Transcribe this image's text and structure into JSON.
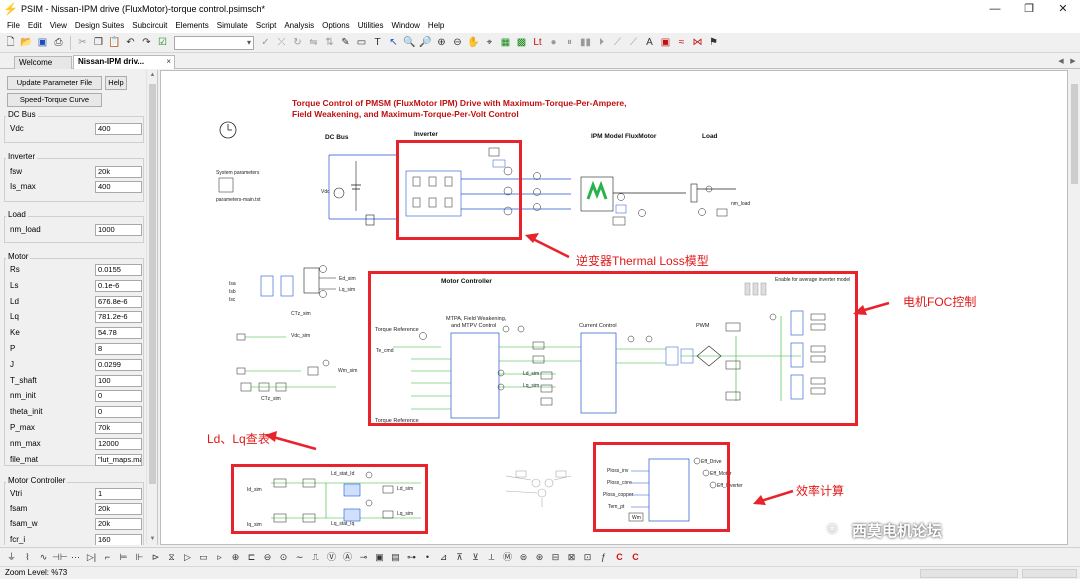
{
  "window": {
    "title": "PSIM - Nissan-IPM drive (FluxMotor)-torque control.psimsch*",
    "minimize": "—",
    "maximize": "❐",
    "close": "✕"
  },
  "menu": [
    "File",
    "Edit",
    "View",
    "Design Suites",
    "Subcircuit",
    "Elements",
    "Simulate",
    "Script",
    "Analysis",
    "Options",
    "Utilities",
    "Window",
    "Help"
  ],
  "tabs": {
    "welcome": "Welcome",
    "active": "Nissan-IPM driv...",
    "close": "×"
  },
  "panel": {
    "buttons": {
      "update": "Update Parameter File",
      "help": "Help",
      "speed_torque": "Speed-Torque Curve"
    },
    "groups": {
      "dc_bus": {
        "title": "DC Bus",
        "params": [
          {
            "label": "Vdc",
            "value": "400"
          }
        ]
      },
      "inverter": {
        "title": "Inverter",
        "params": [
          {
            "label": "fsw",
            "value": "20k"
          },
          {
            "label": "Is_max",
            "value": "400"
          }
        ]
      },
      "load": {
        "title": "Load",
        "params": [
          {
            "label": "nm_load",
            "value": "1000"
          }
        ]
      },
      "motor": {
        "title": "Motor",
        "params": [
          {
            "label": "Rs",
            "value": "0.0155"
          },
          {
            "label": "Ls",
            "value": "0.1e-6"
          },
          {
            "label": "Ld",
            "value": "676.8e-6"
          },
          {
            "label": "Lq",
            "value": "781.2e-6"
          },
          {
            "label": "Ke",
            "value": "54.78"
          },
          {
            "label": "P",
            "value": "8"
          },
          {
            "label": "J",
            "value": "0.0299"
          },
          {
            "label": "T_shaft",
            "value": "100"
          },
          {
            "label": "nm_init",
            "value": "0"
          },
          {
            "label": "theta_init",
            "value": "0"
          },
          {
            "label": "P_max",
            "value": "70k"
          },
          {
            "label": "nm_max",
            "value": "12000"
          },
          {
            "label": "file_mat",
            "value": "\"lut_maps.mat"
          }
        ]
      },
      "motor_controller": {
        "title": "Motor Controller",
        "params": [
          {
            "label": "Vtri",
            "value": "1"
          },
          {
            "label": "fsam",
            "value": "20k"
          },
          {
            "label": "fsam_w",
            "value": "20k"
          },
          {
            "label": "fcr_i",
            "value": "160"
          }
        ]
      }
    }
  },
  "schematic": {
    "heading_line1": "Torque Control of PMSM (FluxMotor IPM) Drive with Maximum-Torque-Per-Ampere,",
    "heading_line2": "Field Weakening, and Maximum-Torque-Per-Volt Control",
    "sections": {
      "dc_bus": "DC Bus",
      "inverter": "Inverter",
      "ipm_model": "IPM Model FluxMotor",
      "load": "Load",
      "motor_controller": "Motor Controller",
      "mtpa": "MTPA, Field Weakening,",
      "mtpv": "and MTPV Control",
      "current_control": "Current Control",
      "pwm": "PWM",
      "torque_ref": "Torque Reference",
      "torque_ref2": "Torque Reference",
      "enable_note": "Enable for average inverter model",
      "sys_params": "System parameters",
      "param_file": "parameters-main.txt"
    },
    "small_labels": {
      "ctz_sim": "CTz_sim",
      "ctz_sim2": "CTz_sim",
      "ed_sim": "Ed_sim",
      "lq_sim": "Lq_sim",
      "vdc_sim": "Vdc_sim",
      "wm_sim": "Wm_sim",
      "ld_sim": "Ld_sim",
      "lq_sim2": "Lq_sim",
      "tcmd": "Te_cmd",
      "ld_stat": "Ld_stat_Id",
      "lq_stat": "Lq_stat_Iq",
      "ld_sim3": "Ld_sim",
      "lq_sim3": "Lq_sim",
      "id_sim": "Id_sim",
      "iq_sim": "Iq_sim",
      "pr_drive": "Eff_Drive",
      "pr_motor": "Eff_Motor",
      "pr_inverter": "Eff_Inverter",
      "ploss_inv": "Ploss_inv",
      "ploss_core": "Ploss_core",
      "ploss_copper": "Ploss_copper",
      "tem_pt": "Tem_pt",
      "wm": "Wm",
      "ia": "Isa",
      "ib": "Isb",
      "ic": "Isc",
      "vdc": "Vdc",
      "nm_load": "nm_load"
    },
    "annotations": {
      "inverter_loss": "逆变器Thermal Loss模型",
      "foc": "电机FOC控制",
      "ldlq": "Ld、Lq查表",
      "efficiency": "效率计算"
    }
  },
  "watermark": "西莫电机论坛",
  "status": {
    "zoom": "Zoom Level: %73"
  },
  "colors": {
    "annotation_red": "#e8232b",
    "heading_red": "#c01010",
    "wire_green": "#2db52d",
    "wire_blue": "#2255cc"
  }
}
